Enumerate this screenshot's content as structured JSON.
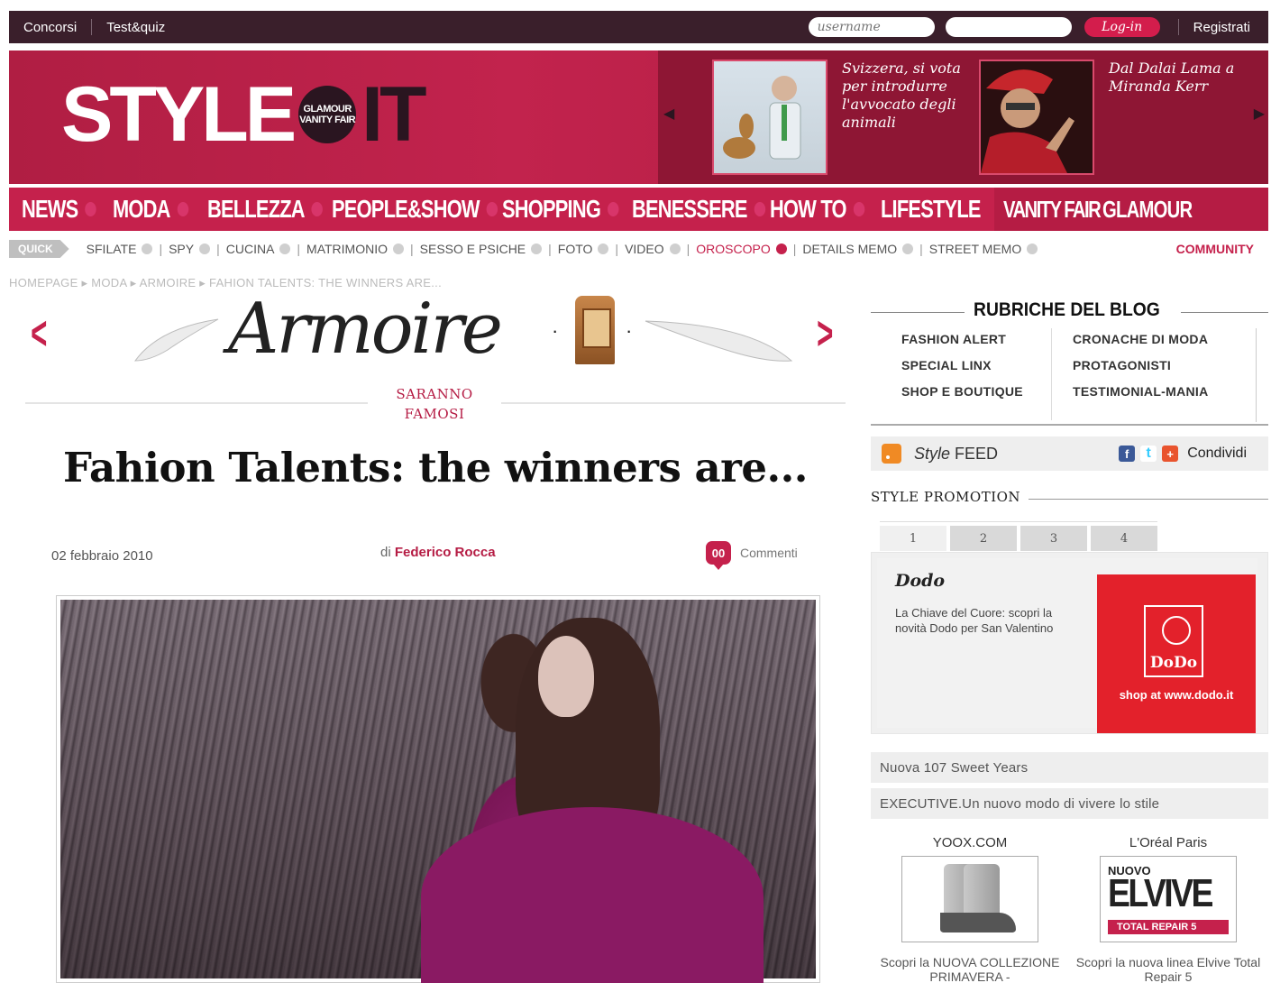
{
  "topbar": {
    "links": [
      "Concorsi",
      "Test&quiz"
    ],
    "username_placeholder": "username",
    "login_label": "Log-in",
    "register_label": "Registrati"
  },
  "header": {
    "logo_left": "STYLE",
    "logo_badge_1": "GLAMOUR",
    "logo_badge_2": "VANITY FAIR",
    "logo_right": "IT",
    "promos": [
      {
        "text": "Svizzera, si vota per introdurre l'avvocato degli animali"
      },
      {
        "text": "Dal Dalai Lama a Miranda Kerr"
      }
    ]
  },
  "mainnav": {
    "items": [
      "NEWS",
      "MODA",
      "BELLEZZA",
      "PEOPLE&SHOW",
      "SHOPPING",
      "BENESSERE",
      "HOW TO",
      "LIFESTYLE"
    ],
    "brands": [
      "VANITY FAIR",
      "GLAMOUR"
    ]
  },
  "subnav": {
    "quick_label": "QUICK",
    "items": [
      "SFILATE",
      "SPY",
      "CUCINA",
      "MATRIMONIO",
      "SESSO E PSICHE",
      "FOTO",
      "VIDEO",
      "OROSCOPO",
      "DETAILS MEMO",
      "STREET MEMO"
    ],
    "community_label": "COMMUNITY"
  },
  "breadcrumb": "HOMEPAGE ▸ MODA ▸ ARMOIRE ▸ FAHION TALENTS: THE WINNERS ARE...",
  "banner": {
    "title": "Armoire",
    "section_line1": "SARANNO",
    "section_line2": "FAMOSI"
  },
  "article": {
    "title": "Fahion Talents: the winners are...",
    "date": "02 febbraio 2010",
    "author_prefix": "di",
    "author": "Federico Rocca",
    "comment_count": "00",
    "comments_label": "Commenti"
  },
  "sidebar": {
    "rubriche_title": "RUBRICHE DEL BLOG",
    "rubriche": [
      "FASHION ALERT",
      "CRONACHE DI MODA",
      "SPECIAL LINX",
      "PROTAGONISTI",
      "SHOP E BOUTIQUE",
      "TESTIMONIAL-MANIA"
    ],
    "feed_italic": "Style",
    "feed_label": "FEED",
    "share_label": "Condividi",
    "promotion_title": "STYLE PROMOTION",
    "tabs": [
      "1",
      "2",
      "3",
      "4"
    ],
    "promo_brand": "Dodo",
    "promo_desc": "La Chiave del Cuore: scopri la novità Dodo per San Valentino",
    "promo_ad_logo": "DoDo",
    "promo_ad_url": "shop at www.dodo.it",
    "news": [
      "Nuova 107 Sweet Years",
      "EXECUTIVE.Un nuovo modo di vivere lo stile"
    ],
    "ads": [
      {
        "name": "YOOX.COM",
        "caption": "Scopri la NUOVA COLLEZIONE PRIMAVERA -"
      },
      {
        "name": "L'Oréal Paris",
        "caption": "Scopri la nuova linea Elvive Total Repair 5",
        "product_top": "NUOVO",
        "product_name": "ELVIVE",
        "product_band": "TOTAL REPAIR 5"
      }
    ]
  }
}
